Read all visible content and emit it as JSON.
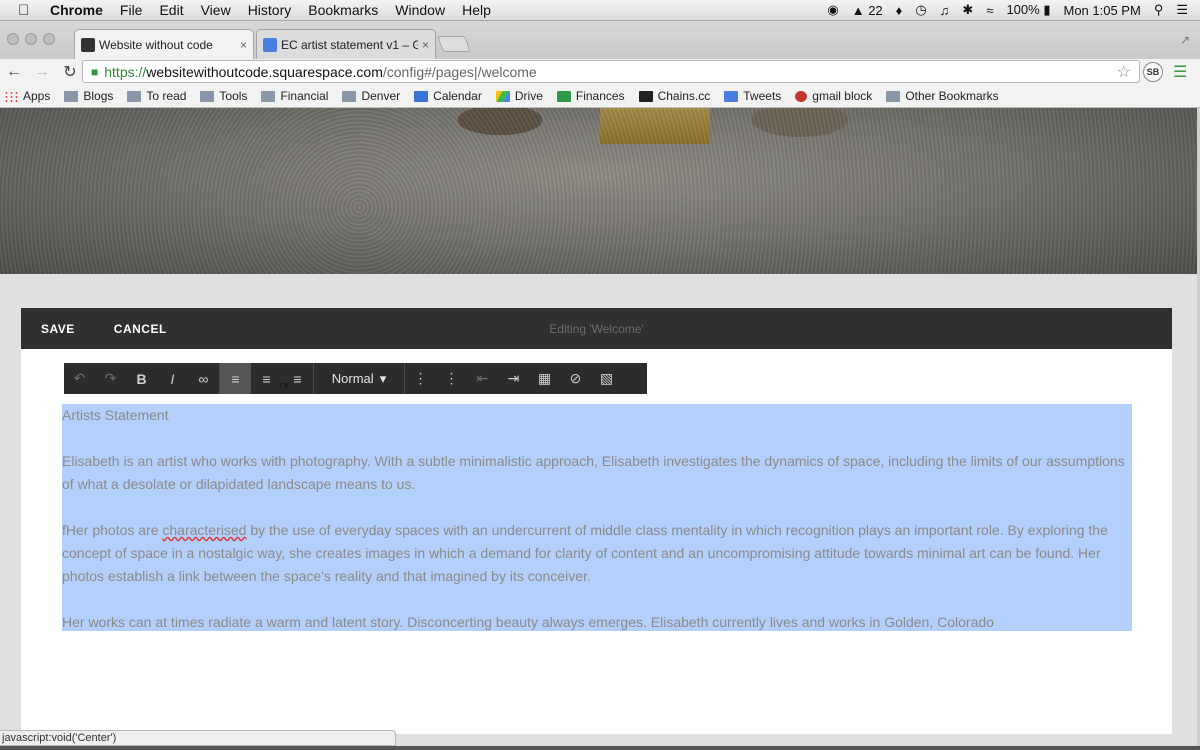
{
  "menubar": {
    "app": "Chrome",
    "items": [
      "File",
      "Edit",
      "View",
      "History",
      "Bookmarks",
      "Window",
      "Help"
    ],
    "status": {
      "notif_count": "22",
      "battery": "100%",
      "clock": "Mon 1:05 PM"
    }
  },
  "tabs": [
    {
      "title": "Website without code",
      "close": "×"
    },
    {
      "title": "EC artist statement v1 – G",
      "close": "×"
    }
  ],
  "omnibox": {
    "scheme": "https://",
    "host": "websitewithoutcode.squarespace.com",
    "path": "/config#/pages|/welcome"
  },
  "sb_badge": "SB",
  "bookmarks": {
    "apps": "Apps",
    "items": [
      "Blogs",
      "To read",
      "Tools",
      "Financial",
      "Denver",
      "Calendar",
      "Drive",
      "Finances",
      "Chains.cc",
      "Tweets",
      "gmail block"
    ],
    "other": "Other Bookmarks"
  },
  "editbar": {
    "save": "SAVE",
    "cancel": "CANCEL",
    "editing": "Editing 'Welcome'"
  },
  "format_toolbar": {
    "style": "Normal"
  },
  "content": {
    "title": "Artists Statement",
    "p1": "Elisabeth is an artist who works with photography. With a subtle minimalistic approach, Elisabeth investigates the dynamics of space, including the limits of our assumptions of what a desolate or dilapidated landscape means to us.",
    "p2_prefix": "fHer photos are ",
    "p2_misspelled": "characterised",
    "p2_rest": " by the use of everyday spaces with an undercurrent of middle class mentality in which recognition plays an important role. By exploring the concept of space in a nostalgic way, she creates images in which a demand for clarity of content and an uncompromising attitude towards minimal art can be found.  Her photos establish a link between the space's reality and that imagined by its conceiver.",
    "p3": "Her works can at times radiate a warm and latent story.  Disconcerting beauty always emerges. Elisabeth currently lives and works in Golden, Colorado"
  },
  "statusbar": "javascript:void('Center')",
  "colors": {
    "selection": "#b3cffb",
    "editbar": "#303030",
    "toolbar": "#2c2c2c",
    "url_green": "#2d8a38"
  }
}
